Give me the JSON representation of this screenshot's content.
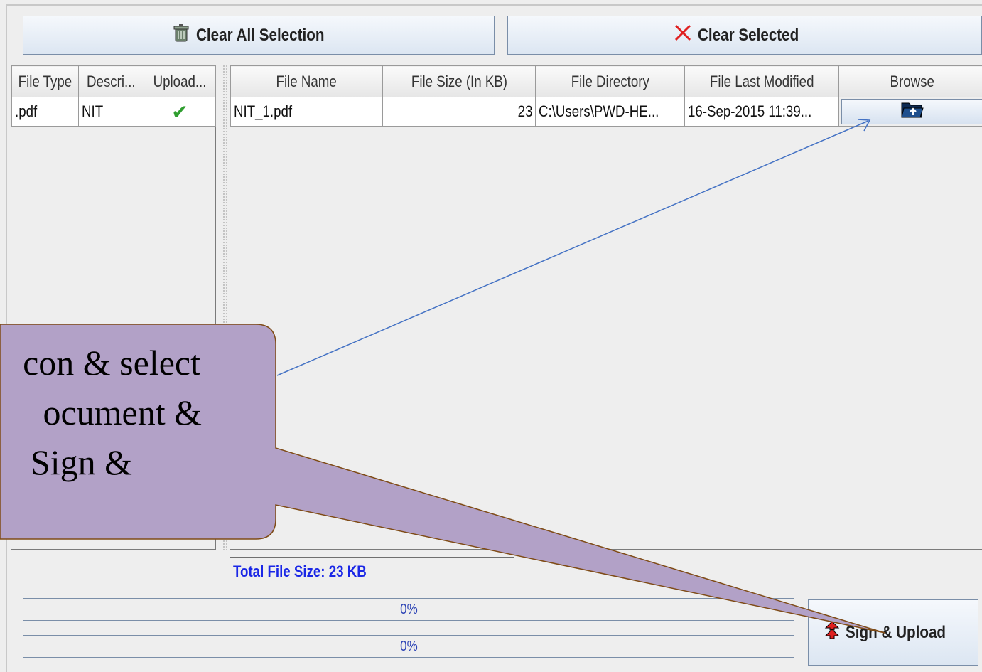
{
  "toolbar": {
    "clear_all_label": "Clear All Selection",
    "clear_selected_label": "Clear Selected"
  },
  "left_table": {
    "headers": [
      "File Type",
      "Descri...",
      "Upload..."
    ],
    "rows": [
      {
        "file_type": ".pdf",
        "description": "NIT",
        "uploaded": "✔"
      }
    ]
  },
  "right_table": {
    "headers": [
      "File Name",
      "File Size (In KB)",
      "File Directory",
      "File Last Modified",
      "Browse"
    ],
    "rows": [
      {
        "file_name": "NIT_1.pdf",
        "file_size": "23",
        "file_directory": "C:\\Users\\PWD-HE...",
        "last_modified": "16-Sep-2015 11:39..."
      }
    ]
  },
  "total_file_size": "Total File Size: 23 KB",
  "progress": [
    {
      "value": "0%"
    },
    {
      "value": "0%"
    }
  ],
  "sign_upload_label": "Sign & Upload",
  "callout": {
    "lines": [
      "con & select",
      "ocument &",
      "Sign &"
    ],
    "fill_color": "#b2a1c7",
    "border_color": "#7f4b16"
  },
  "colors": {
    "accent_blue": "#1a27e6",
    "check_green": "#2f9e2f",
    "arrow_blue": "#4472c4",
    "clear_x_red": "#e02020"
  },
  "icons": {
    "clear_all": "trash-can-icon",
    "clear_selected": "red-x-icon",
    "browse": "folder-open-icon",
    "sign_upload": "red-upload-arrows-icon",
    "upload_status": "green-check-icon"
  }
}
